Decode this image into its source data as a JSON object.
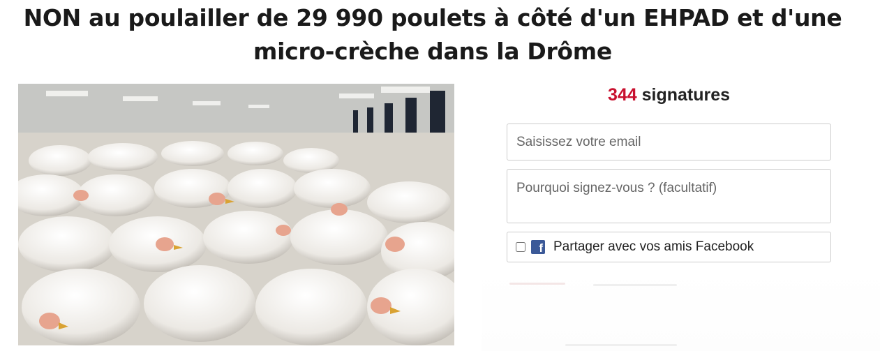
{
  "petition": {
    "title": "NON au poulailler de 29 990 poulets à côté d'un EHPAD et d'une micro-crèche dans la Drôme",
    "signature_count": "344",
    "signature_label": "signatures"
  },
  "form": {
    "email_placeholder": "Saisissez votre email",
    "reason_placeholder": "Pourquoi signez-vous ? (facultatif)",
    "share_label": "Partager avec vos amis Facebook",
    "share_checked": false
  },
  "colors": {
    "accent": "#c8102e",
    "facebook": "#3b5998"
  },
  "icons": {
    "facebook": "facebook-icon"
  }
}
